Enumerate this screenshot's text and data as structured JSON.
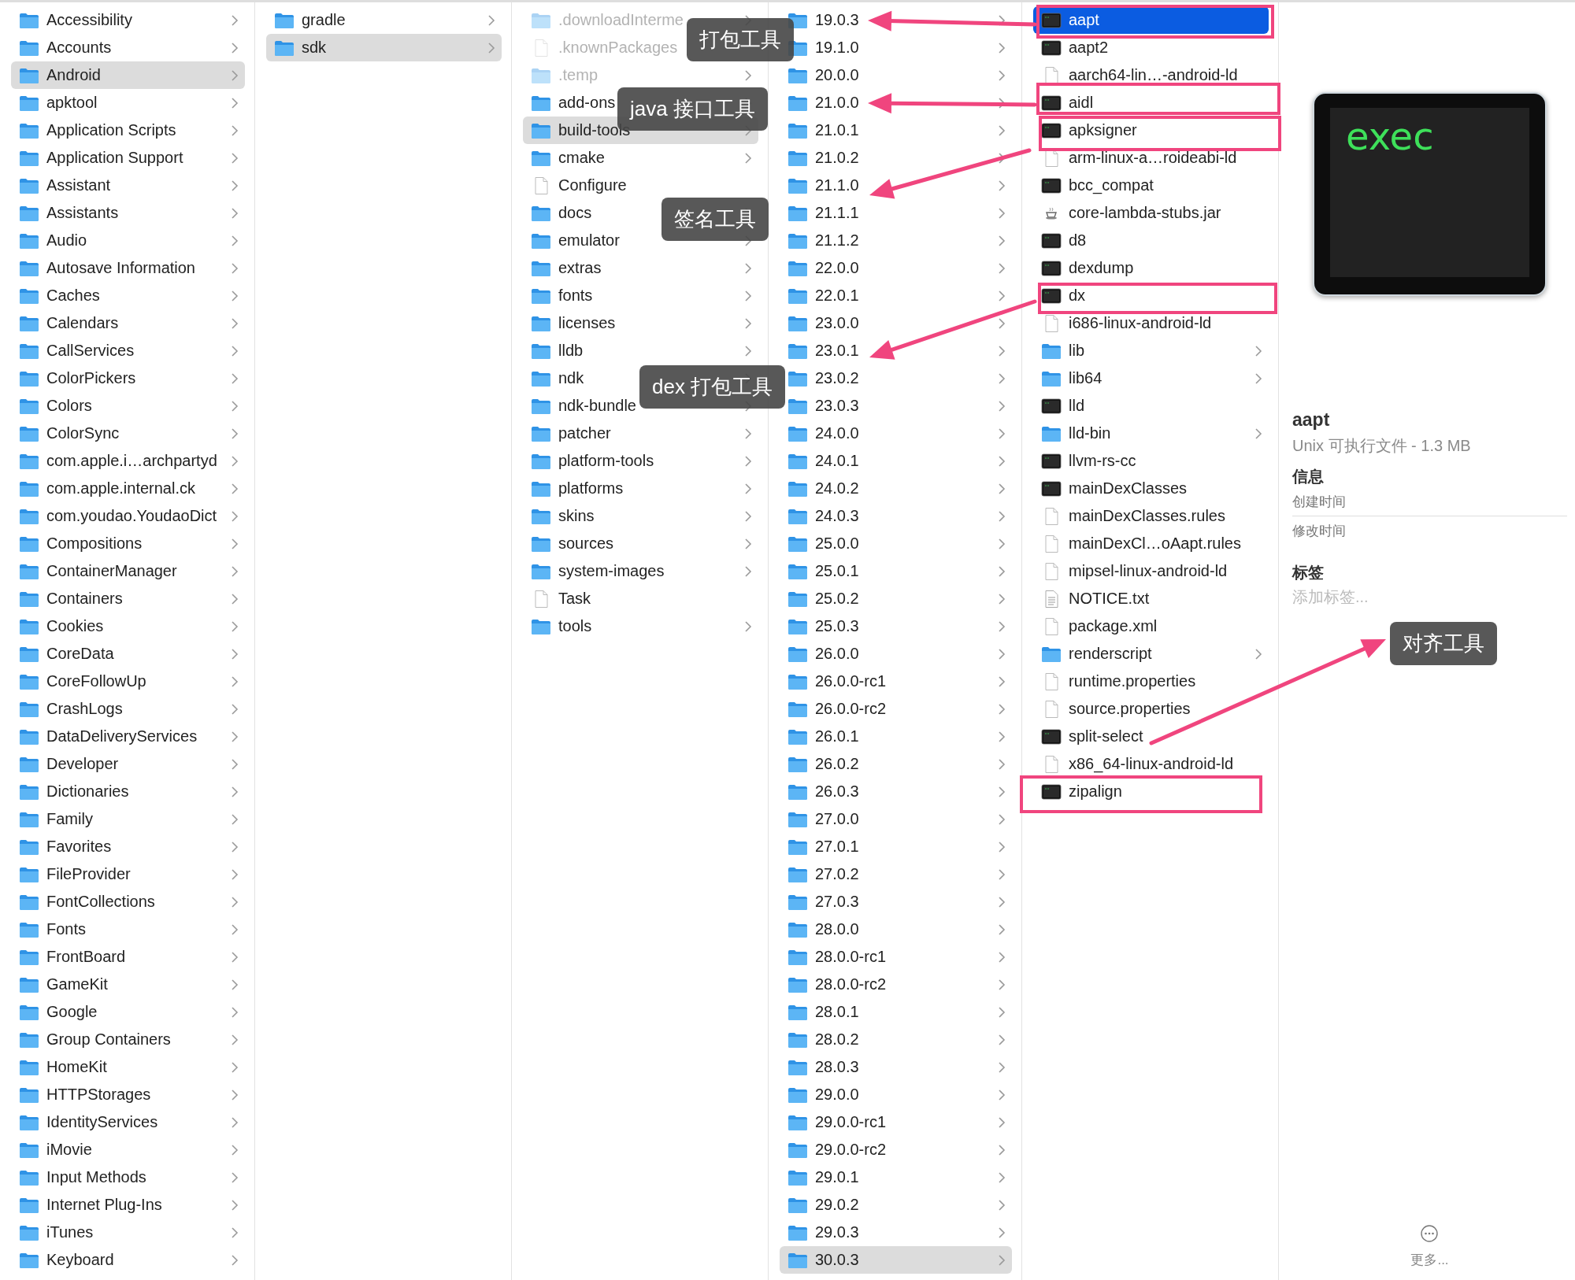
{
  "columns": [
    {
      "active": false,
      "items": [
        {
          "name": "Accessibility",
          "kind": "folder",
          "selected": false
        },
        {
          "name": "Accounts",
          "kind": "folder",
          "selected": false
        },
        {
          "name": "Android",
          "kind": "folder",
          "selected": true
        },
        {
          "name": "apktool",
          "kind": "folder",
          "selected": false
        },
        {
          "name": "Application Scripts",
          "kind": "folder",
          "selected": false
        },
        {
          "name": "Application Support",
          "kind": "folder",
          "selected": false
        },
        {
          "name": "Assistant",
          "kind": "folder",
          "selected": false
        },
        {
          "name": "Assistants",
          "kind": "folder",
          "selected": false
        },
        {
          "name": "Audio",
          "kind": "folder",
          "selected": false
        },
        {
          "name": "Autosave Information",
          "kind": "folder",
          "selected": false
        },
        {
          "name": "Caches",
          "kind": "folder",
          "selected": false
        },
        {
          "name": "Calendars",
          "kind": "folder",
          "selected": false
        },
        {
          "name": "CallServices",
          "kind": "folder",
          "selected": false
        },
        {
          "name": "ColorPickers",
          "kind": "folder",
          "selected": false
        },
        {
          "name": "Colors",
          "kind": "folder",
          "selected": false
        },
        {
          "name": "ColorSync",
          "kind": "folder",
          "selected": false
        },
        {
          "name": "com.apple.i…archpartyd",
          "kind": "folder",
          "selected": false
        },
        {
          "name": "com.apple.internal.ck",
          "kind": "folder",
          "selected": false
        },
        {
          "name": "com.youdao.YoudaoDict",
          "kind": "folder",
          "selected": false
        },
        {
          "name": "Compositions",
          "kind": "folder",
          "selected": false
        },
        {
          "name": "ContainerManager",
          "kind": "folder",
          "selected": false
        },
        {
          "name": "Containers",
          "kind": "folder",
          "selected": false
        },
        {
          "name": "Cookies",
          "kind": "folder",
          "selected": false
        },
        {
          "name": "CoreData",
          "kind": "folder",
          "selected": false
        },
        {
          "name": "CoreFollowUp",
          "kind": "folder",
          "selected": false
        },
        {
          "name": "CrashLogs",
          "kind": "folder",
          "selected": false
        },
        {
          "name": "DataDeliveryServices",
          "kind": "folder",
          "selected": false
        },
        {
          "name": "Developer",
          "kind": "folder",
          "selected": false
        },
        {
          "name": "Dictionaries",
          "kind": "folder",
          "selected": false
        },
        {
          "name": "Family",
          "kind": "folder",
          "selected": false
        },
        {
          "name": "Favorites",
          "kind": "folder",
          "selected": false
        },
        {
          "name": "FileProvider",
          "kind": "folder",
          "selected": false
        },
        {
          "name": "FontCollections",
          "kind": "folder",
          "selected": false
        },
        {
          "name": "Fonts",
          "kind": "folder",
          "selected": false
        },
        {
          "name": "FrontBoard",
          "kind": "folder",
          "selected": false
        },
        {
          "name": "GameKit",
          "kind": "folder",
          "selected": false
        },
        {
          "name": "Google",
          "kind": "folder",
          "selected": false
        },
        {
          "name": "Group Containers",
          "kind": "folder",
          "selected": false
        },
        {
          "name": "HomeKit",
          "kind": "folder",
          "selected": false
        },
        {
          "name": "HTTPStorages",
          "kind": "folder",
          "selected": false
        },
        {
          "name": "IdentityServices",
          "kind": "folder",
          "selected": false
        },
        {
          "name": "iMovie",
          "kind": "folder",
          "selected": false
        },
        {
          "name": "Input Methods",
          "kind": "folder",
          "selected": false
        },
        {
          "name": "Internet Plug-Ins",
          "kind": "folder",
          "selected": false
        },
        {
          "name": "iTunes",
          "kind": "folder",
          "selected": false
        },
        {
          "name": "Keyboard",
          "kind": "folder",
          "selected": false
        }
      ]
    },
    {
      "active": false,
      "items": [
        {
          "name": "gradle",
          "kind": "folder",
          "selected": false
        },
        {
          "name": "sdk",
          "kind": "folder",
          "selected": true
        }
      ]
    },
    {
      "active": false,
      "items": [
        {
          "name": ".downloadInterme",
          "kind": "hidden_folder",
          "selected": false
        },
        {
          "name": ".knownPackages",
          "kind": "hidden_file",
          "selected": false
        },
        {
          "name": ".temp",
          "kind": "hidden_folder",
          "selected": false
        },
        {
          "name": "add-ons",
          "kind": "folder",
          "selected": false
        },
        {
          "name": "build-tools",
          "kind": "folder",
          "selected": true
        },
        {
          "name": "cmake",
          "kind": "folder",
          "selected": false
        },
        {
          "name": "Configure",
          "kind": "file",
          "selected": false
        },
        {
          "name": "docs",
          "kind": "folder",
          "selected": false
        },
        {
          "name": "emulator",
          "kind": "folder",
          "selected": false
        },
        {
          "name": "extras",
          "kind": "folder",
          "selected": false
        },
        {
          "name": "fonts",
          "kind": "folder",
          "selected": false
        },
        {
          "name": "licenses",
          "kind": "folder",
          "selected": false
        },
        {
          "name": "lldb",
          "kind": "folder",
          "selected": false
        },
        {
          "name": "ndk",
          "kind": "folder",
          "selected": false
        },
        {
          "name": "ndk-bundle",
          "kind": "folder",
          "selected": false
        },
        {
          "name": "patcher",
          "kind": "folder",
          "selected": false
        },
        {
          "name": "platform-tools",
          "kind": "folder",
          "selected": false
        },
        {
          "name": "platforms",
          "kind": "folder",
          "selected": false
        },
        {
          "name": "skins",
          "kind": "folder",
          "selected": false
        },
        {
          "name": "sources",
          "kind": "folder",
          "selected": false
        },
        {
          "name": "system-images",
          "kind": "folder",
          "selected": false
        },
        {
          "name": "Task",
          "kind": "file",
          "selected": false
        },
        {
          "name": "tools",
          "kind": "folder",
          "selected": false
        }
      ]
    },
    {
      "active": false,
      "items": [
        {
          "name": "19.0.3",
          "kind": "folder",
          "selected": false
        },
        {
          "name": "19.1.0",
          "kind": "folder",
          "selected": false
        },
        {
          "name": "20.0.0",
          "kind": "folder",
          "selected": false
        },
        {
          "name": "21.0.0",
          "kind": "folder",
          "selected": false
        },
        {
          "name": "21.0.1",
          "kind": "folder",
          "selected": false
        },
        {
          "name": "21.0.2",
          "kind": "folder",
          "selected": false
        },
        {
          "name": "21.1.0",
          "kind": "folder",
          "selected": false
        },
        {
          "name": "21.1.1",
          "kind": "folder",
          "selected": false
        },
        {
          "name": "21.1.2",
          "kind": "folder",
          "selected": false
        },
        {
          "name": "22.0.0",
          "kind": "folder",
          "selected": false
        },
        {
          "name": "22.0.1",
          "kind": "folder",
          "selected": false
        },
        {
          "name": "23.0.0",
          "kind": "folder",
          "selected": false
        },
        {
          "name": "23.0.1",
          "kind": "folder",
          "selected": false
        },
        {
          "name": "23.0.2",
          "kind": "folder",
          "selected": false
        },
        {
          "name": "23.0.3",
          "kind": "folder",
          "selected": false
        },
        {
          "name": "24.0.0",
          "kind": "folder",
          "selected": false
        },
        {
          "name": "24.0.1",
          "kind": "folder",
          "selected": false
        },
        {
          "name": "24.0.2",
          "kind": "folder",
          "selected": false
        },
        {
          "name": "24.0.3",
          "kind": "folder",
          "selected": false
        },
        {
          "name": "25.0.0",
          "kind": "folder",
          "selected": false
        },
        {
          "name": "25.0.1",
          "kind": "folder",
          "selected": false
        },
        {
          "name": "25.0.2",
          "kind": "folder",
          "selected": false
        },
        {
          "name": "25.0.3",
          "kind": "folder",
          "selected": false
        },
        {
          "name": "26.0.0",
          "kind": "folder",
          "selected": false
        },
        {
          "name": "26.0.0-rc1",
          "kind": "folder",
          "selected": false
        },
        {
          "name": "26.0.0-rc2",
          "kind": "folder",
          "selected": false
        },
        {
          "name": "26.0.1",
          "kind": "folder",
          "selected": false
        },
        {
          "name": "26.0.2",
          "kind": "folder",
          "selected": false
        },
        {
          "name": "26.0.3",
          "kind": "folder",
          "selected": false
        },
        {
          "name": "27.0.0",
          "kind": "folder",
          "selected": false
        },
        {
          "name": "27.0.1",
          "kind": "folder",
          "selected": false
        },
        {
          "name": "27.0.2",
          "kind": "folder",
          "selected": false
        },
        {
          "name": "27.0.3",
          "kind": "folder",
          "selected": false
        },
        {
          "name": "28.0.0",
          "kind": "folder",
          "selected": false
        },
        {
          "name": "28.0.0-rc1",
          "kind": "folder",
          "selected": false
        },
        {
          "name": "28.0.0-rc2",
          "kind": "folder",
          "selected": false
        },
        {
          "name": "28.0.1",
          "kind": "folder",
          "selected": false
        },
        {
          "name": "28.0.2",
          "kind": "folder",
          "selected": false
        },
        {
          "name": "28.0.3",
          "kind": "folder",
          "selected": false
        },
        {
          "name": "29.0.0",
          "kind": "folder",
          "selected": false
        },
        {
          "name": "29.0.0-rc1",
          "kind": "folder",
          "selected": false
        },
        {
          "name": "29.0.0-rc2",
          "kind": "folder",
          "selected": false
        },
        {
          "name": "29.0.1",
          "kind": "folder",
          "selected": false
        },
        {
          "name": "29.0.2",
          "kind": "folder",
          "selected": false
        },
        {
          "name": "29.0.3",
          "kind": "folder",
          "selected": false
        },
        {
          "name": "30.0.3",
          "kind": "folder",
          "selected": true
        }
      ]
    },
    {
      "active": true,
      "items": [
        {
          "name": "aapt",
          "kind": "exec",
          "selected": true
        },
        {
          "name": "aapt2",
          "kind": "exec",
          "selected": false
        },
        {
          "name": "aarch64-lin…-android-ld",
          "kind": "file",
          "selected": false
        },
        {
          "name": "aidl",
          "kind": "exec",
          "selected": false
        },
        {
          "name": "apksigner",
          "kind": "exec",
          "selected": false
        },
        {
          "name": "arm-linux-a…roideabi-ld",
          "kind": "file",
          "selected": false
        },
        {
          "name": "bcc_compat",
          "kind": "exec",
          "selected": false
        },
        {
          "name": "core-lambda-stubs.jar",
          "kind": "jar",
          "selected": false
        },
        {
          "name": "d8",
          "kind": "exec",
          "selected": false
        },
        {
          "name": "dexdump",
          "kind": "exec",
          "selected": false
        },
        {
          "name": "dx",
          "kind": "exec",
          "selected": false
        },
        {
          "name": "i686-linux-android-ld",
          "kind": "file",
          "selected": false
        },
        {
          "name": "lib",
          "kind": "folder",
          "selected": false
        },
        {
          "name": "lib64",
          "kind": "folder",
          "selected": false
        },
        {
          "name": "lld",
          "kind": "exec",
          "selected": false
        },
        {
          "name": "lld-bin",
          "kind": "folder",
          "selected": false
        },
        {
          "name": "llvm-rs-cc",
          "kind": "exec",
          "selected": false
        },
        {
          "name": "mainDexClasses",
          "kind": "exec",
          "selected": false
        },
        {
          "name": "mainDexClasses.rules",
          "kind": "file",
          "selected": false
        },
        {
          "name": "mainDexCl…oAapt.rules",
          "kind": "file",
          "selected": false
        },
        {
          "name": "mipsel-linux-android-ld",
          "kind": "file",
          "selected": false
        },
        {
          "name": "NOTICE.txt",
          "kind": "text",
          "selected": false
        },
        {
          "name": "package.xml",
          "kind": "file",
          "selected": false
        },
        {
          "name": "renderscript",
          "kind": "folder",
          "selected": false
        },
        {
          "name": "runtime.properties",
          "kind": "file",
          "selected": false
        },
        {
          "name": "source.properties",
          "kind": "file",
          "selected": false
        },
        {
          "name": "split-select",
          "kind": "exec",
          "selected": false
        },
        {
          "name": "x86_64-linux-android-ld",
          "kind": "file",
          "selected": false
        },
        {
          "name": "zipalign",
          "kind": "exec",
          "selected": false
        }
      ]
    }
  ],
  "preview": {
    "icon_text": "exec",
    "name": "aapt",
    "subtitle": "Unix 可执行文件 - 1.3 MB",
    "info_heading": "信息",
    "info_rows": [
      {
        "label": "创建时间"
      },
      {
        "label": "修改时间"
      }
    ],
    "tags_heading": "标签",
    "tags_placeholder": "添加标签...",
    "more": "更多..."
  },
  "annotations": [
    {
      "label": "打包工具"
    },
    {
      "label": "java 接口工具"
    },
    {
      "label": "签名工具"
    },
    {
      "label": "dex 打包工具"
    },
    {
      "label": "对齐工具"
    }
  ]
}
